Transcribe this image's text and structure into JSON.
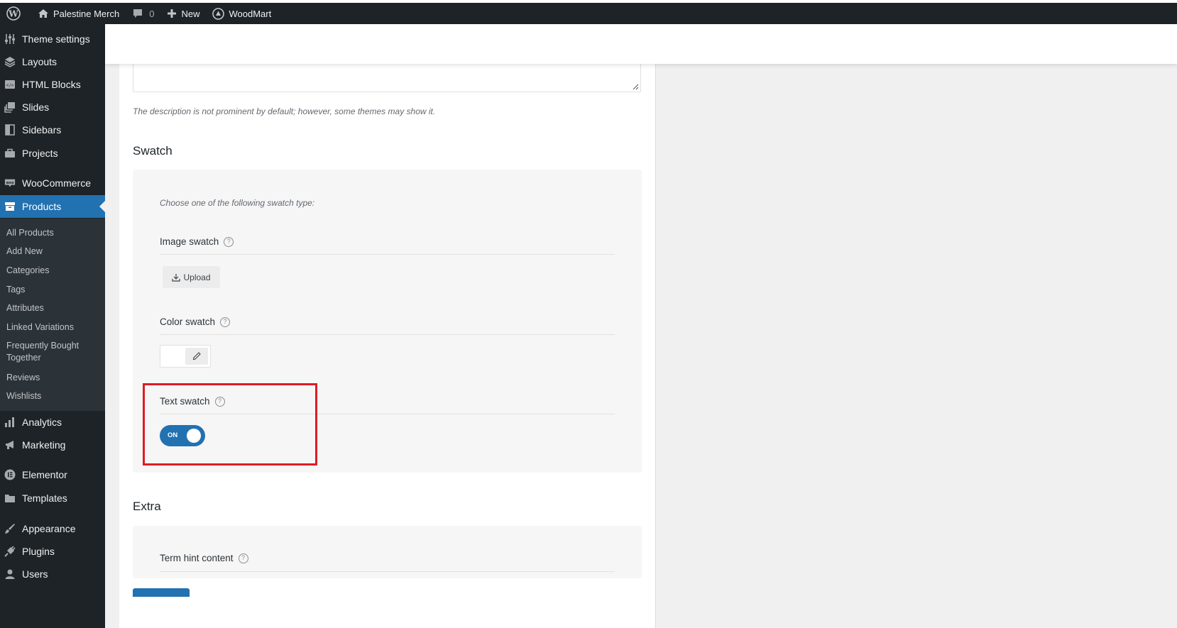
{
  "adminbar": {
    "site_name": "Palestine Merch",
    "comments_count": "0",
    "new_label": "New",
    "theme_label": "WoodMart"
  },
  "sidebar": {
    "items": [
      {
        "label": "Theme settings",
        "icon": "sliders-icon"
      },
      {
        "label": "Layouts",
        "icon": "layers-icon"
      },
      {
        "label": "HTML Blocks",
        "icon": "code-block-icon"
      },
      {
        "label": "Slides",
        "icon": "slides-icon"
      },
      {
        "label": "Sidebars",
        "icon": "sidebar-icon"
      },
      {
        "label": "Projects",
        "icon": "briefcase-icon"
      },
      {
        "label": "WooCommerce",
        "icon": "woo-icon"
      },
      {
        "label": "Products",
        "icon": "archive-icon"
      },
      {
        "label": "Analytics",
        "icon": "bar-chart-icon"
      },
      {
        "label": "Marketing",
        "icon": "megaphone-icon"
      },
      {
        "label": "Elementor",
        "icon": "elementor-icon"
      },
      {
        "label": "Templates",
        "icon": "folder-icon"
      },
      {
        "label": "Appearance",
        "icon": "paintbrush-icon"
      },
      {
        "label": "Plugins",
        "icon": "plug-icon"
      },
      {
        "label": "Users",
        "icon": "user-icon"
      }
    ],
    "submenu": [
      "All Products",
      "Add New",
      "Categories",
      "Tags",
      "Attributes",
      "Linked Variations",
      "Frequently Bought Together",
      "Reviews",
      "Wishlists"
    ]
  },
  "form": {
    "description_note": "The description is not prominent by default; however, some themes may show it.",
    "swatch_title": "Swatch",
    "swatch_hint": "Choose one of the following swatch type:",
    "image_swatch_label": "Image swatch",
    "upload_label": "Upload",
    "color_swatch_label": "Color swatch",
    "text_swatch_label": "Text swatch",
    "toggle_label": "ON",
    "extra_title": "Extra",
    "term_hint_label": "Term hint content",
    "help_glyph": "?"
  },
  "colors": {
    "accent": "#2271b1",
    "highlight": "#e01b24",
    "admin_bg": "#1d2327"
  }
}
